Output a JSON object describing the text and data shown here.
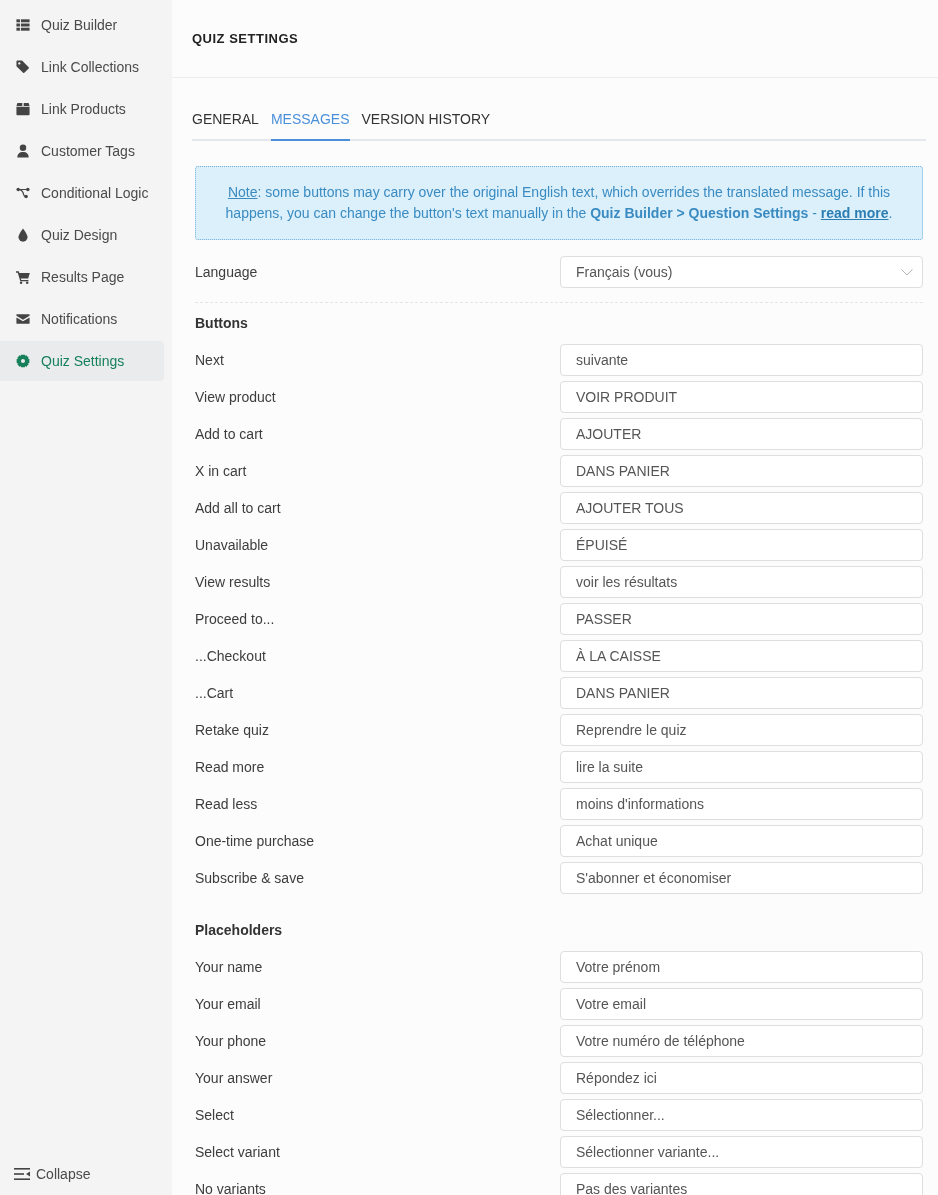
{
  "sidebar": {
    "items": [
      {
        "label": "Quiz Builder",
        "selected": false
      },
      {
        "label": "Link Collections",
        "selected": false
      },
      {
        "label": "Link Products",
        "selected": false
      },
      {
        "label": "Customer Tags",
        "selected": false
      },
      {
        "label": "Conditional Logic",
        "selected": false
      },
      {
        "label": "Quiz Design",
        "selected": false
      },
      {
        "label": "Results Page",
        "selected": false
      },
      {
        "label": "Notifications",
        "selected": false
      },
      {
        "label": "Quiz Settings",
        "selected": true
      }
    ],
    "collapse": "Collapse"
  },
  "header": {
    "title": "QUIZ SETTINGS"
  },
  "tabs": [
    {
      "label": "GENERAL",
      "selected": false
    },
    {
      "label": "MESSAGES",
      "selected": true
    },
    {
      "label": "VERSION HISTORY",
      "selected": false
    }
  ],
  "note": {
    "lead": "Note",
    "text": ": some buttons may carry over the original English text, which overrides the translated message. If this happens, you can change the button's text manually in the **Quiz Builder > Question Settings** - ",
    "link": "read more",
    "end": "."
  },
  "language": {
    "label": "Language",
    "value": "Français (vous)"
  },
  "sections": [
    {
      "title": "Buttons",
      "rows": [
        {
          "label": "Next",
          "value": "suivante"
        },
        {
          "label": "View product",
          "value": "VOIR PRODUIT"
        },
        {
          "label": "Add to cart",
          "value": "AJOUTER"
        },
        {
          "label": "X in cart",
          "value": "DANS PANIER"
        },
        {
          "label": "Add all to cart",
          "value": "AJOUTER TOUS"
        },
        {
          "label": "Unavailable",
          "value": "ÉPUISÉ"
        },
        {
          "label": "View results",
          "value": "voir les résultats"
        },
        {
          "label": "Proceed to...",
          "value": "PASSER"
        },
        {
          "label": "...Checkout",
          "value": "À LA CAISSE"
        },
        {
          "label": "...Cart",
          "value": "DANS PANIER"
        },
        {
          "label": "Retake quiz",
          "value": "Reprendre le quiz"
        },
        {
          "label": "Read more",
          "value": "lire la suite"
        },
        {
          "label": "Read less",
          "value": "moins d'informations"
        },
        {
          "label": "One-time purchase",
          "value": "Achat unique"
        },
        {
          "label": "Subscribe & save",
          "value": "S'abonner et économiser"
        }
      ]
    },
    {
      "title": "Placeholders",
      "rows": [
        {
          "label": "Your name",
          "value": "Votre prénom"
        },
        {
          "label": "Your email",
          "value": "Votre email"
        },
        {
          "label": "Your phone",
          "value": "Votre numéro de téléphone"
        },
        {
          "label": "Your answer",
          "value": "Répondez ici"
        },
        {
          "label": "Select",
          "value": "Sélectionner..."
        },
        {
          "label": "Select variant",
          "value": "Sélectionner variante..."
        },
        {
          "label": "No variants",
          "value": "Pas des variantes"
        }
      ]
    }
  ]
}
